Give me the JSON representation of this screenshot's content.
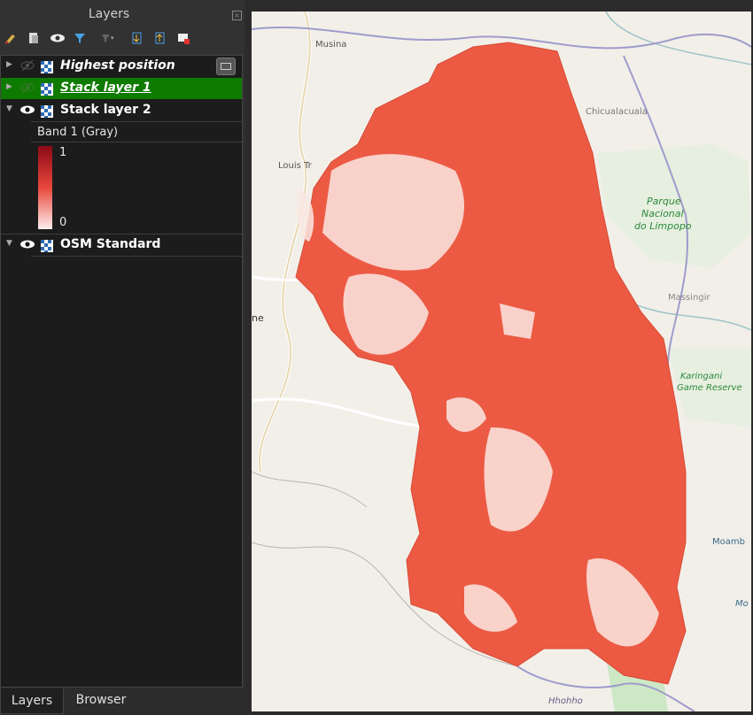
{
  "panel": {
    "title": "Layers",
    "close_glyph": "×"
  },
  "toolbar": {
    "icons": [
      "style-manager-icon",
      "add-group-icon",
      "visibility-eye-icon",
      "filter-icon",
      "filter-expression-icon",
      "expand-all-icon",
      "collapse-all-icon",
      "remove-layer-icon"
    ]
  },
  "layers": [
    {
      "name": "Highest position",
      "visible": false,
      "selected": false,
      "italic": true
    },
    {
      "name": "Stack layer 1",
      "visible": false,
      "selected": true,
      "italic": true
    },
    {
      "name": "Stack layer 2",
      "visible": true,
      "selected": false,
      "italic": false
    },
    {
      "name": "OSM Standard",
      "visible": true,
      "selected": false,
      "italic": false
    }
  ],
  "legend": {
    "band_label": "Band 1 (Gray)",
    "max": "1",
    "min": "0",
    "ramp_colors": [
      "#8b0a16",
      "#e8463a",
      "#fdeeee"
    ]
  },
  "tabs": {
    "layers": "Layers",
    "browser": "Browser"
  },
  "map": {
    "labels": {
      "musina": "Musina",
      "chicualacuala": "Chicualacuala",
      "louis_tr": "Louis Tr",
      "parque": "Parque",
      "nacional": "Nacional",
      "limpopo": "do Limpopo",
      "massingir": "Massingir",
      "karingani": "Karingani",
      "game_reserve": "Game Reserve",
      "ne": "ne",
      "moamba": "Moamb",
      "mo": "Mo",
      "hhohho": "Hhohho"
    },
    "colors": {
      "background": "#f2efe9",
      "raster": "#ec5a44",
      "park": "#cde8c4",
      "border": "#9e9ccc"
    }
  }
}
